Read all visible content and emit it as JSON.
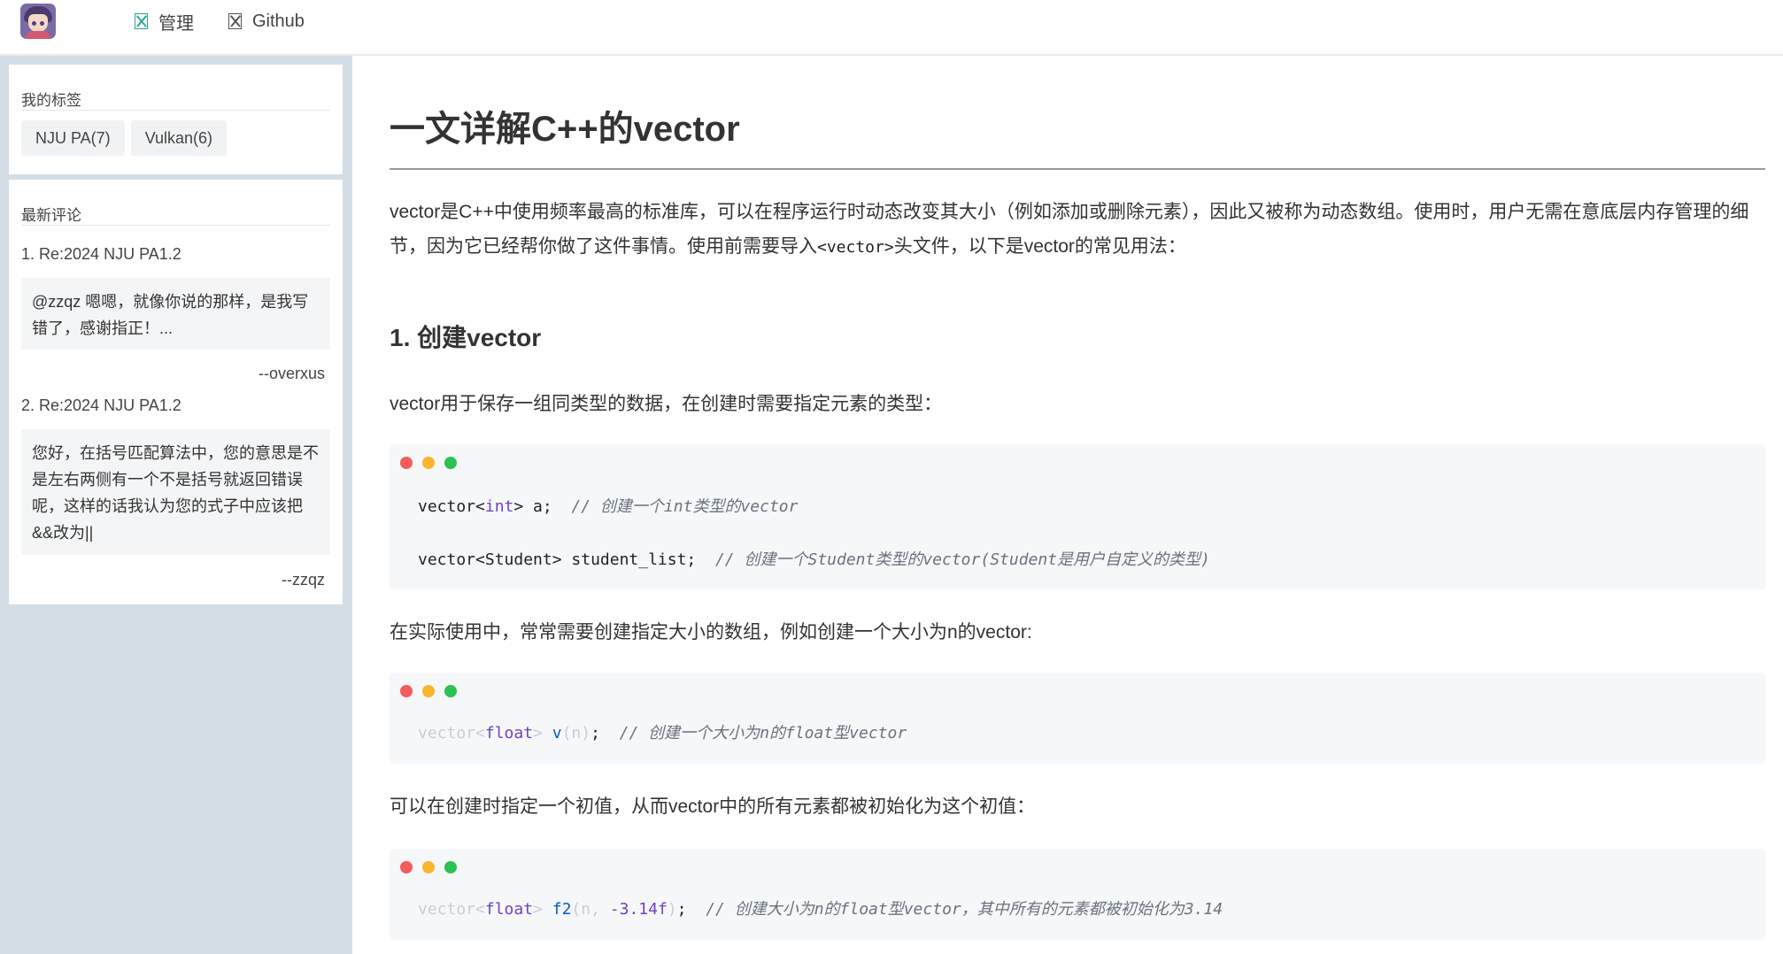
{
  "nav": {
    "manage_label": "管理",
    "github_label": "Github"
  },
  "sidebar": {
    "tags_title": "我的标签",
    "tags": [
      "NJU PA(7)",
      "Vulkan(6)"
    ],
    "comments_title": "最新评论",
    "comments": [
      {
        "title": "1. Re:2024 NJU PA1.2",
        "body": "@zzqz 嗯嗯，就像你说的那样，是我写错了，感谢指正！...",
        "author": "--overxus"
      },
      {
        "title": "2. Re:2024 NJU PA1.2",
        "body": "您好，在括号匹配算法中，您的意思是不是左右两侧有一个不是括号就返回错误呢，这样的话我认为您的式子中应该把&&改为||",
        "author": "--zzqz"
      }
    ]
  },
  "article": {
    "title": "一文详解C++的vector",
    "intro_part1": "vector是C++中使用频率最高的标准库，可以在程序运行时动态改变其大小（例如添加或删除元素），因此又被称为动态数组。使用时，用户无需在意底层内存管理的细节，因为它已经帮你做了这件事情。使用前需要导入",
    "intro_code": "<vector>",
    "intro_part2": "头文件，以下是vector的常见用法：",
    "h1": "1. 创建vector",
    "p1": "vector用于保存一组同类型的数据，在创建时需要指定元素的类型：",
    "code1_line1_a": "vector<",
    "code1_line1_kw": "int",
    "code1_line1_b": "> a;",
    "code1_line1_cm": "// 创建一个int类型的vector",
    "code1_line2_a": "vector<Student> student_list;",
    "code1_line2_cm": "// 创建一个Student类型的vector(Student是用户自定义的类型)",
    "p2": "在实际使用中，常常需要创建指定大小的数组，例如创建一个大小为n的vector:",
    "code2_pre": "vector<",
    "code2_kw": "float",
    "code2_mid": "> ",
    "code2_fn": "v",
    "code2_arg": "(n)",
    "code2_end": ";",
    "code2_cm": "// 创建一个大小为n的float型vector",
    "p3": "可以在创建时指定一个初值，从而vector中的所有元素都被初始化为这个初值：",
    "code3_pre": "vector<",
    "code3_kw": "float",
    "code3_mid": "> ",
    "code3_fn": "f2",
    "code3_arg1": "(n, ",
    "code3_num": "-3.14f",
    "code3_arg2": ")",
    "code3_end": ";",
    "code3_cm": "// 创建大小为n的float型vector，其中所有的元素都被初始化为3.14"
  }
}
